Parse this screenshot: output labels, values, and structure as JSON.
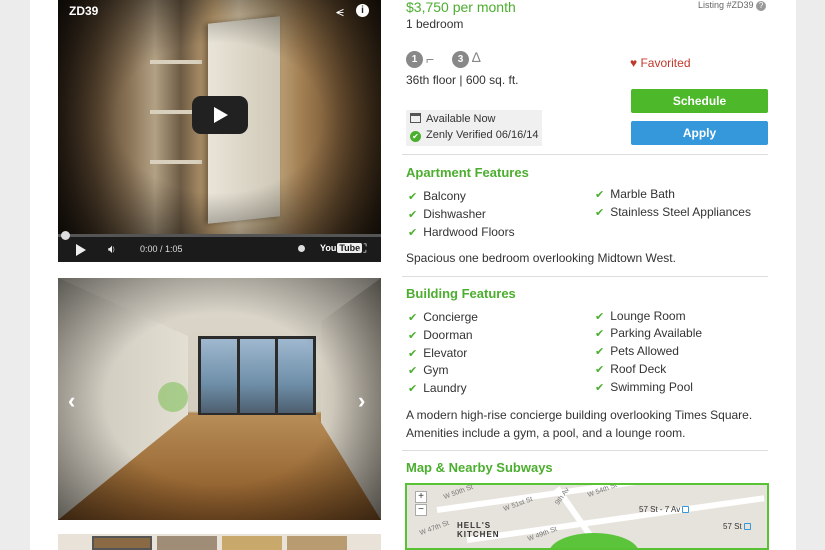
{
  "video": {
    "id_label": "ZD39",
    "time": "0:00 / 1:05",
    "youtube_a": "You",
    "youtube_b": "Tube"
  },
  "listing": {
    "price": "$3,750 per month",
    "bedrooms": "1 bedroom",
    "listing_id": "Listing #ZD39",
    "bathrooms_count": "1",
    "closets_count": "3",
    "floor_info": "36th floor | 600 sq. ft.",
    "favorited": "Favorited",
    "available": "Available Now",
    "verified": "Zenly Verified 06/16/14"
  },
  "actions": {
    "schedule": "Schedule",
    "apply": "Apply"
  },
  "apartment": {
    "title": "Apartment Features",
    "features_left": [
      "Balcony",
      "Dishwasher",
      "Hardwood Floors"
    ],
    "features_right": [
      "Marble Bath",
      "Stainless Steel Appliances"
    ],
    "description": "Spacious one bedroom overlooking Midtown West."
  },
  "building": {
    "title": "Building Features",
    "features_left": [
      "Concierge",
      "Doorman",
      "Elevator",
      "Gym",
      "Laundry"
    ],
    "features_right": [
      "Lounge Room",
      "Parking Available",
      "Pets Allowed",
      "Roof Deck",
      "Swimming Pool"
    ],
    "description_line1": "A modern high-rise concierge building overlooking Times Square.",
    "description_line2": "Amenities include a gym, a pool, and a lounge room."
  },
  "map": {
    "title": "Map & Nearby Subways",
    "zoom_in": "+",
    "zoom_out": "−",
    "neighborhood_line1": "HELL'S",
    "neighborhood_line2": "KITCHEN",
    "station_1": "57 St - 7 Av",
    "station_2": "57 St",
    "streets": [
      "W 50th St",
      "W 51st St",
      "W 47th St",
      "W 54th St",
      "9th Av",
      "W 49th St"
    ]
  },
  "colors": {
    "accent_green": "#4cae2f",
    "schedule_button": "#4cb82a",
    "apply_button": "#3498db",
    "favorite_red": "#c0392b"
  }
}
